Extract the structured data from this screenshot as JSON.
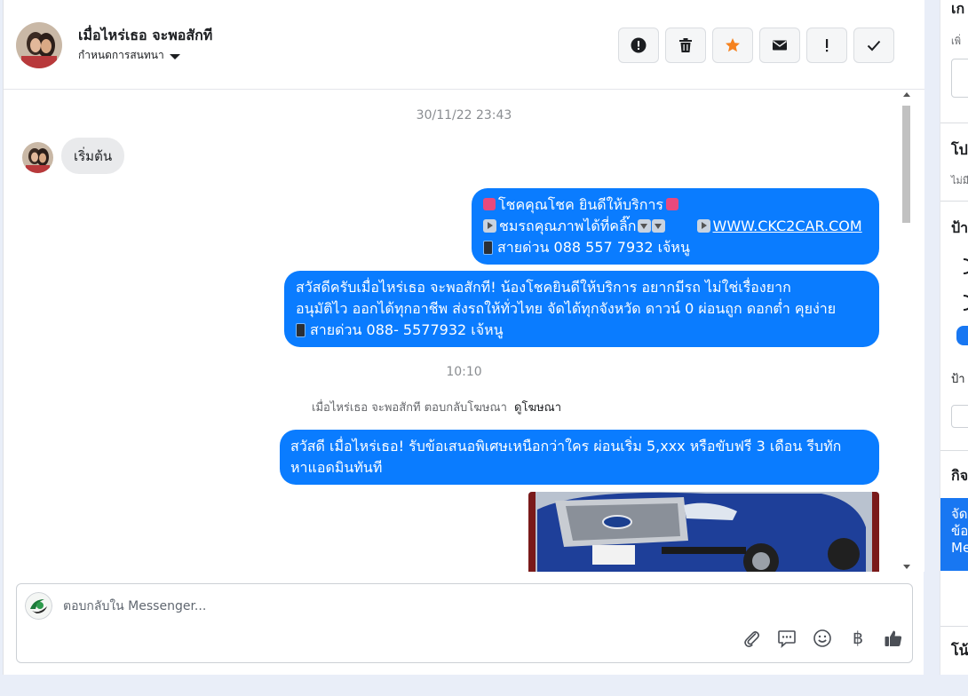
{
  "header": {
    "name": "เมื่อไหร่เธอ จะพอสักที",
    "subtitle": "กำหนดการสนทนา"
  },
  "toolbar": {
    "icons": [
      "alert-circle-icon",
      "trash-icon",
      "star-icon",
      "envelope-icon",
      "exclamation-icon",
      "check-icon"
    ],
    "star_color": "#f5821f"
  },
  "messages": {
    "timestamp1": "30/11/22 23:43",
    "start_label": "เริ่มต้น",
    "bubble1": {
      "line1": "โชคคุณโชค ยินดีให้บริการ",
      "line2_text": "ชมรถคุณภาพได้ที่คลิ๊ก",
      "line2_link": "WWW.CKC2CAR.COM",
      "line3": "สายด่วน 088 557 7932 เจ้หนู"
    },
    "bubble2": {
      "line1": "สวัสดีครับเมื่อไหร่เธอ จะพอสักที! น้องโชคยินดีให้บริการ อยากมีรถ ไม่ใช่เรื่องยาก",
      "line2": "อนุมัติไว ออกได้ทุกอาชีพ ส่งรถให้ทั่วไทย จัดได้ทุกจังหวัด ดาวน์ 0  ผ่อนถูก ดอกต่ำ คุยง่าย",
      "line3": "สายด่วน 088- 5577932 เจ้หนู"
    },
    "timestamp2": "10:10",
    "ad_reply_text": "เมื่อไหร่เธอ จะพอสักที ตอบกลับโฆษณา",
    "ad_reply_link": "ดูโฆษณา",
    "bubble3": {
      "line1": "สวัสดี เมื่อไหร่เธอ! รับข้อเสนอพิเศษเหนือกว่าใคร ผ่อนเริ่ม 5,xxx หรือขับฟรี 3 เดือน รีบทัก",
      "line2": "หาแอดมินทันที"
    },
    "outgoing_color": "#0a7cff"
  },
  "composer": {
    "placeholder": "ตอบกลับใน Messenger...",
    "tools": [
      "paperclip-icon",
      "speech-bubble-icon",
      "smiley-icon",
      "baht-icon",
      "thumbs-up-icon"
    ],
    "baht_symbol": "฿"
  },
  "side_panel": {
    "t1": "เก",
    "t2": "เพิ่",
    "t3": "โป",
    "t4": "ไม่มี",
    "t5": "ป้า",
    "t6": "ป้า",
    "t7": "กิจ",
    "blue_l1": "จัด",
    "blue_l2": "ข้อ",
    "blue_l3": "Me",
    "t8": "โน้"
  }
}
